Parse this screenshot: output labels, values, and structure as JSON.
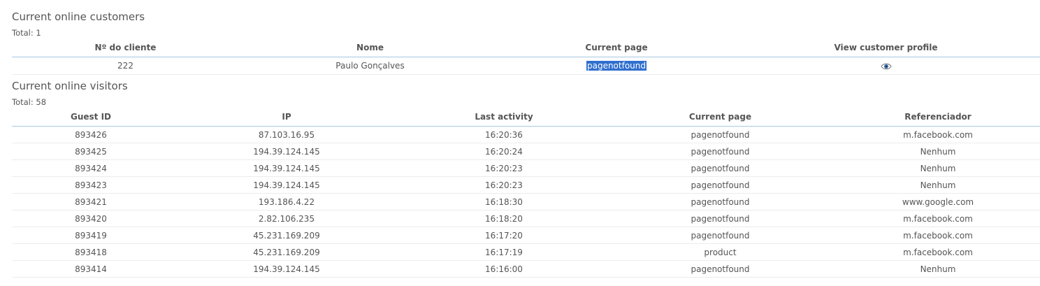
{
  "customers": {
    "title": "Current online customers",
    "total": "Total: 1",
    "columns": [
      "Nº do cliente",
      "Nome",
      "Current page",
      "View customer profile"
    ],
    "rows": [
      {
        "id": "222",
        "name": "Paulo Gonçalves",
        "page": "pagenotfound",
        "action_icon": "eye-icon"
      }
    ]
  },
  "visitors": {
    "title": "Current online visitors",
    "total": "Total: 58",
    "columns": [
      "Guest ID",
      "IP",
      "Last activity",
      "Current page",
      "Referenciador"
    ],
    "rows": [
      [
        "893426",
        "87.103.16.95",
        "16:20:36",
        "pagenotfound",
        "m.facebook.com"
      ],
      [
        "893425",
        "194.39.124.145",
        "16:20:24",
        "pagenotfound",
        "Nenhum"
      ],
      [
        "893424",
        "194.39.124.145",
        "16:20:23",
        "pagenotfound",
        "Nenhum"
      ],
      [
        "893423",
        "194.39.124.145",
        "16:20:23",
        "pagenotfound",
        "Nenhum"
      ],
      [
        "893421",
        "193.186.4.22",
        "16:18:30",
        "pagenotfound",
        "www.google.com"
      ],
      [
        "893420",
        "2.82.106.235",
        "16:18:20",
        "pagenotfound",
        "m.facebook.com"
      ],
      [
        "893419",
        "45.231.169.209",
        "16:17:20",
        "pagenotfound",
        "m.facebook.com"
      ],
      [
        "893418",
        "45.231.169.209",
        "16:17:19",
        "product",
        "m.facebook.com"
      ],
      [
        "893414",
        "194.39.124.145",
        "16:16:00",
        "pagenotfound",
        "Nenhum"
      ]
    ]
  },
  "colors": {
    "text": "#555555",
    "header_border": "#a8c8e0",
    "selection": "#2f6fce"
  }
}
